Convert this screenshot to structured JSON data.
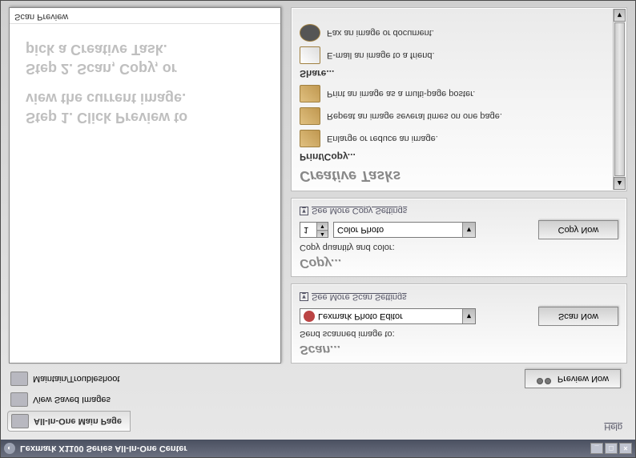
{
  "window": {
    "title": "Lexmark X1100 Series All-In-One Center"
  },
  "tabs": {
    "main": "All-In-One Main Page",
    "saved": "View Saved Images",
    "maintain": "Maintain/Troubleshoot"
  },
  "top": {
    "preview_now": "Preview Now",
    "help": "Help"
  },
  "preview": {
    "step1a": "Step 1.  Click Preview to",
    "step1b": "view the current image.",
    "step2a": "Step 2.  Scan, Copy, or",
    "step2b": "pick a Creative Task.",
    "panel_title": "Scan Preview"
  },
  "scan": {
    "title": "Scan...",
    "send_label": "Send scanned image to:",
    "selected": "Lexmark Photo Editor",
    "button": "Scan Now",
    "more": "See More Scan Settings"
  },
  "copy": {
    "title": "Copy...",
    "qc_label": "Copy quantity and color:",
    "qty": "1",
    "selected": "Color Photo",
    "button": "Copy Now",
    "more": "See More Copy Settings"
  },
  "creative": {
    "header": "Creative Tasks",
    "printcopy": "Print/Copy...",
    "items_pc": [
      "Enlarge or reduce an image.",
      "Repeat an image several times on one page.",
      "Print an image as a multi-page poster."
    ],
    "share": "Share...",
    "items_share": [
      "E-mail an image to a friend.",
      "Fax an image or document."
    ]
  }
}
